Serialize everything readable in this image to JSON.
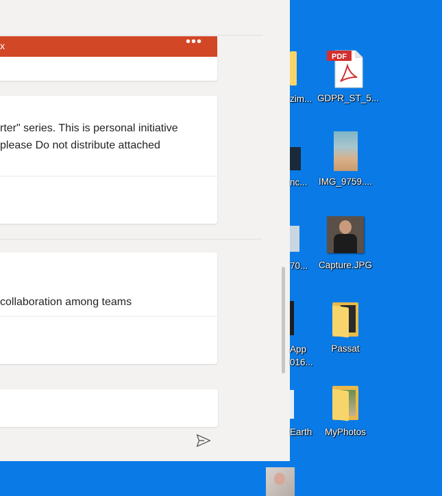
{
  "teams": {
    "card1": {
      "close_glyph": "x",
      "more_glyph": "•••"
    },
    "card2": {
      "line1": "rter\" series. This is personal initiative",
      "line2": "please Do not distribute attached"
    },
    "card3": {
      "line1": "collaboration among teams"
    }
  },
  "desktop": {
    "icons": [
      {
        "label": "GDPR_ST_5...",
        "badge": "PDF"
      },
      {
        "label": "IMG_9759...."
      },
      {
        "label": "Capture.JPG"
      },
      {
        "label": "Passat"
      },
      {
        "label": "MyPhotos"
      }
    ],
    "partial_labels": [
      "zim...",
      "nc...",
      "70...",
      "App",
      "016...",
      "Earth"
    ]
  },
  "colors": {
    "desktop_bg": "#0a7be6",
    "window_bg": "#f3f2f1",
    "accent_red": "#d24726"
  }
}
